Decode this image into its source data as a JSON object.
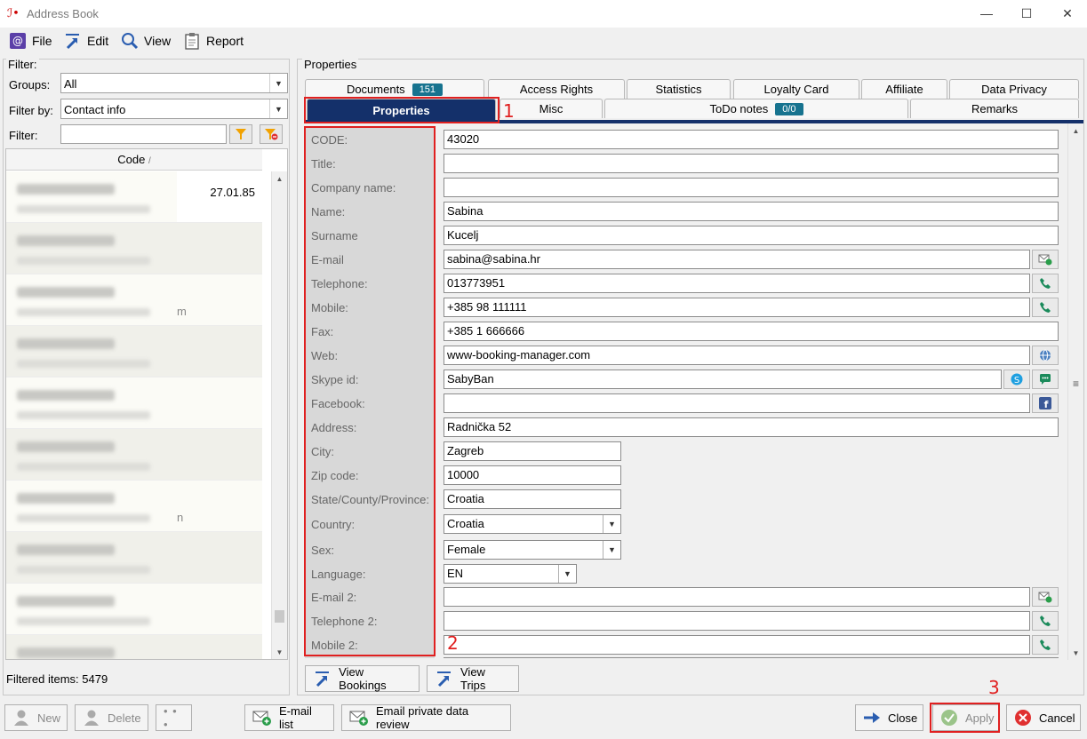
{
  "window": {
    "title": "Address Book",
    "min_icon": "minimize-icon",
    "max_icon": "maximize-icon",
    "close_icon": "close-icon"
  },
  "menu": [
    {
      "label": "File",
      "icon": "at-icon"
    },
    {
      "label": "Edit",
      "icon": "edit-arrow-icon"
    },
    {
      "label": "View",
      "icon": "magnifier-icon"
    },
    {
      "label": "Report",
      "icon": "clipboard-icon"
    }
  ],
  "filter": {
    "legend": "Filter:",
    "groups_label": "Groups:",
    "groups_value": "All",
    "filter_by_label": "Filter by:",
    "filter_by_value": "Contact info",
    "filter_label": "Filter:",
    "filter_value": "",
    "column_header": "Code",
    "sort_indicator": "/",
    "first_row_date": "27.01.85",
    "row_tails": [
      "",
      "",
      "m",
      "",
      "",
      "",
      "n",
      "",
      "",
      ""
    ],
    "filtered_label": "Filtered items:",
    "filtered_count": "5479"
  },
  "properties": {
    "legend": "Properties",
    "tabs_row1": [
      {
        "label": "Documents",
        "badge": "151"
      },
      {
        "label": "Access Rights"
      },
      {
        "label": "Statistics"
      },
      {
        "label": "Loyalty Card"
      },
      {
        "label": "Affiliate"
      },
      {
        "label": "Data Privacy"
      }
    ],
    "tabs_row2": [
      {
        "label": "Properties",
        "active": true
      },
      {
        "label": "Misc"
      },
      {
        "label": "ToDo notes",
        "badge": "0/0"
      },
      {
        "label": "Remarks"
      }
    ],
    "fields": [
      {
        "label": "CODE:",
        "value": "43020"
      },
      {
        "label": "Title:",
        "value": ""
      },
      {
        "label": "Company name:",
        "value": ""
      },
      {
        "label": "Name:",
        "value": "Sabina"
      },
      {
        "label": "Surname",
        "value": "Kucelj"
      },
      {
        "label": "E-mail",
        "value": "sabina@sabina.hr"
      },
      {
        "label": "Telephone:",
        "value": "013773951"
      },
      {
        "label": "Mobile:",
        "value": "+385 98 111111"
      },
      {
        "label": "Fax:",
        "value": "+385 1 666666"
      },
      {
        "label": "Web:",
        "value": "www-booking-manager.com"
      },
      {
        "label": "Skype id:",
        "value": "SabyBan"
      },
      {
        "label": "Facebook:",
        "value": ""
      },
      {
        "label": "Address:",
        "value": "Radnička 52"
      },
      {
        "label": "City:",
        "value": "Zagreb"
      },
      {
        "label": "Zip code:",
        "value": "10000"
      },
      {
        "label": "State/County/Province:",
        "value": "Croatia"
      },
      {
        "label": "Country:",
        "value": "Croatia"
      },
      {
        "label": "Sex:",
        "value": "Female"
      },
      {
        "label": "Language:",
        "value": "EN"
      },
      {
        "label": "E-mail 2:",
        "value": ""
      },
      {
        "label": "Telephone 2:",
        "value": ""
      },
      {
        "label": "Mobile 2:",
        "value": ""
      }
    ],
    "view_bookings": "View Bookings",
    "view_trips": "View Trips"
  },
  "annotations": {
    "one": "1",
    "two": "2",
    "three": "3"
  },
  "bottom": {
    "new": "New",
    "delete": "Delete",
    "more": "• • •",
    "email_list": "E-mail list",
    "email_private": "Email private data review",
    "close": "Close",
    "apply": "Apply",
    "cancel": "Cancel"
  },
  "colors": {
    "accent_navy": "#14306a",
    "badge_teal": "#17738f",
    "highlight_red": "#e02020",
    "phone_green": "#1a8a5a"
  }
}
